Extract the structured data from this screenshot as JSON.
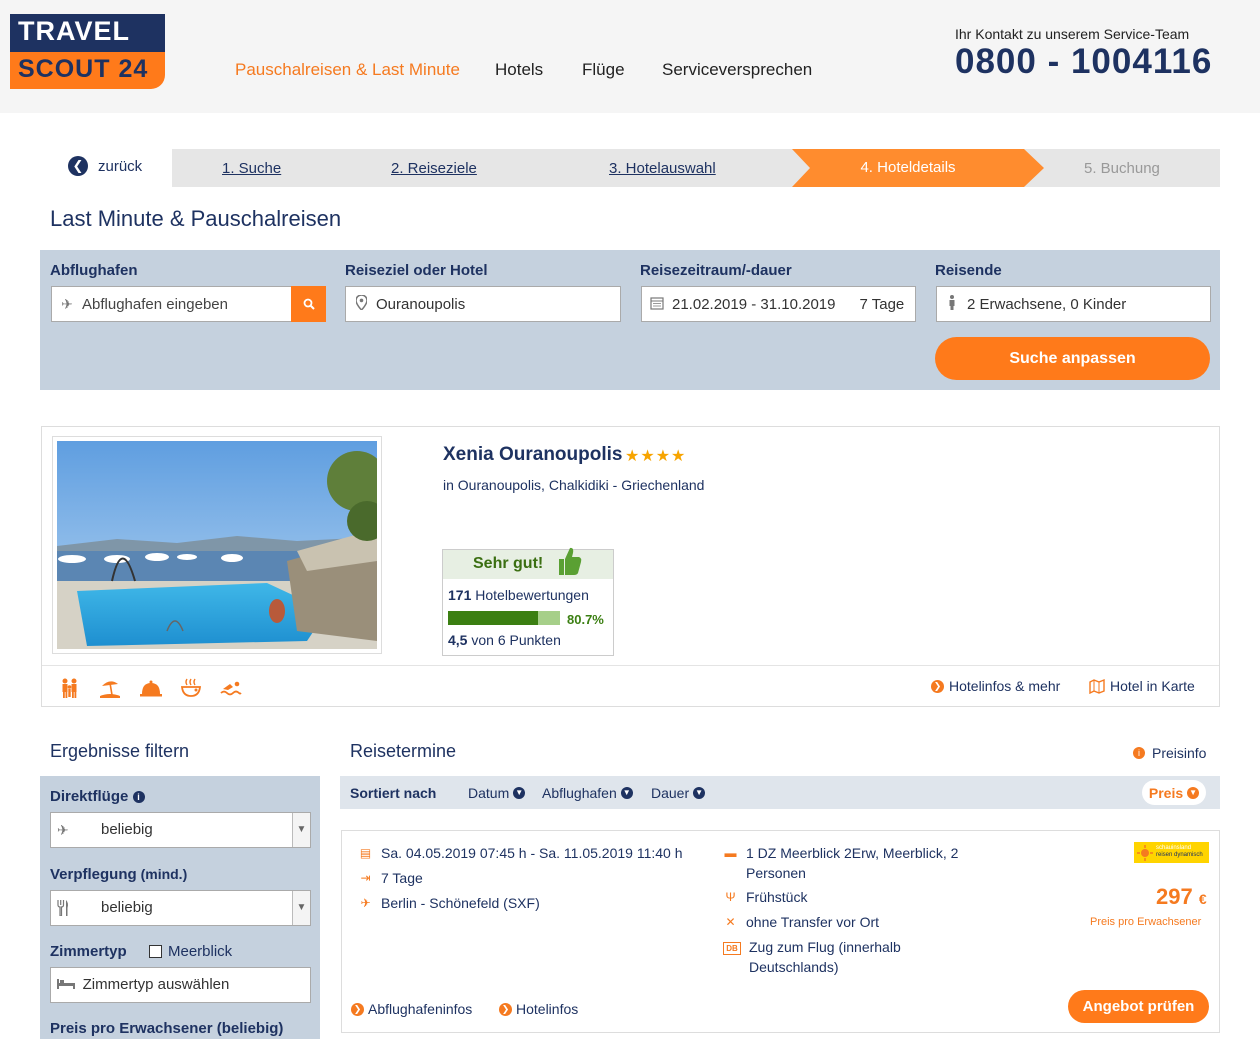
{
  "brand": {
    "line1": "TRAVEL",
    "line2": "SCOUT 24"
  },
  "nav": {
    "items": [
      "Pauschalreisen & Last Minute",
      "Hotels",
      "Flüge",
      "Serviceversprechen"
    ]
  },
  "contact": {
    "label": "Ihr Kontakt zu unserem Service-Team",
    "phone": "0800 - 1004116"
  },
  "steps": {
    "back": "zurück",
    "items": [
      "1. Suche",
      "2. Reiseziele",
      "3. Hotelauswahl",
      "4. Hoteldetails",
      "5. Buchung"
    ],
    "active_index": 3
  },
  "page_title": "Last Minute & Pauschalreisen",
  "search": {
    "airport_label": "Abflughafen",
    "airport_placeholder": "Abflughafen eingeben",
    "destination_label": "Reiseziel oder Hotel",
    "destination_value": "Ouranoupolis",
    "period_label": "Reisezeitraum/-dauer",
    "period_value": "21.02.2019 - 31.10.2019",
    "duration_value": "7 Tage",
    "travelers_label": "Reisende",
    "travelers_value": "2 Erwachsene, 0 Kinder",
    "submit_label": "Suche anpassen"
  },
  "hotel": {
    "name": "Xenia Ouranoupolis",
    "stars": "★★★★",
    "star_count": 4,
    "location": "in Ouranoupolis, Chalkidiki - Griechenland",
    "rating": {
      "verdict": "Sehr gut!",
      "count": "171",
      "count_label": " Hotelbewertungen",
      "percent": "80.7%",
      "percent_value": 80.7,
      "points": "4,5",
      "points_label": " von 6 Punkten"
    },
    "links": {
      "info": "Hotelinfos & mehr",
      "map": "Hotel in Karte"
    },
    "amenity_icons": [
      "family-icon",
      "beach-icon",
      "service-bell-icon",
      "wellness-icon",
      "swimming-icon"
    ]
  },
  "filters": {
    "title": "Ergebnisse filtern",
    "direct_label": "Direktflüge",
    "direct_value": "beliebig",
    "board_label": "Verpflegung",
    "board_suffix": " (mind.)",
    "board_value": "beliebig",
    "room_label": "Zimmertyp",
    "room_checkbox": "Meerblick",
    "room_placeholder": "Zimmertyp auswählen",
    "price_label": "Preis pro Erwachsener",
    "price_suffix": " (beliebig)"
  },
  "results": {
    "title": "Reisetermine",
    "info_link": "Preisinfo",
    "sort_label": "Sortiert nach",
    "sort_options": [
      "Datum",
      "Abflughafen",
      "Dauer"
    ],
    "sort_active": "Preis"
  },
  "offer": {
    "dates": "Sa. 04.05.2019 07:45 h - Sa. 11.05.2019 11:40 h",
    "duration": "7 Tage",
    "airport": "Berlin - Schönefeld (SXF)",
    "room": "1 DZ Meerblick 2Erw, Meerblick, 2 Personen",
    "board": "Frühstück",
    "transfer": "ohne Transfer vor Ort",
    "train_badge": "DB",
    "train": "Zug zum Flug (innerhalb Deutschlands)",
    "operator_line1": "schauinsland",
    "operator_line2": "reisen dynamisch",
    "price": "297",
    "currency": "€",
    "price_note": "Preis pro Erwachsener",
    "links": [
      "Abflughafeninfos",
      "Hotelinfos"
    ],
    "cta": "Angebot prüfen"
  },
  "colors": {
    "navy": "#1e3261",
    "orange": "#ff7a1a",
    "search_bg": "#c5d1de",
    "rating_green": "#3b7f12"
  }
}
